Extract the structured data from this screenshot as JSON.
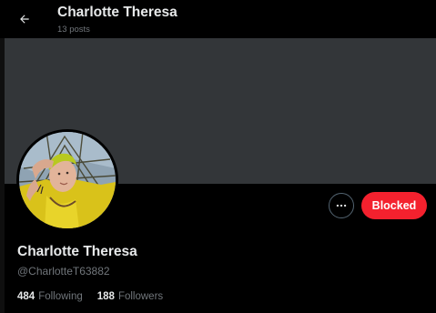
{
  "header": {
    "back_icon": "arrow-left-icon",
    "title": "Charlotte Theresa",
    "post_count": "13 posts"
  },
  "profile": {
    "display_name": "Charlotte Theresa",
    "handle": "@CharlotteT63882",
    "following_count": "484",
    "following_label": "Following",
    "followers_count": "188",
    "followers_label": "Followers"
  },
  "actions": {
    "more_icon": "more-horizontal-icon",
    "blocked_label": "Blocked"
  },
  "colors": {
    "background": "#000000",
    "banner": "#333639",
    "blocked_button": "#f4212e",
    "primary_text": "#e7e9ea",
    "secondary_text": "#71767b"
  }
}
